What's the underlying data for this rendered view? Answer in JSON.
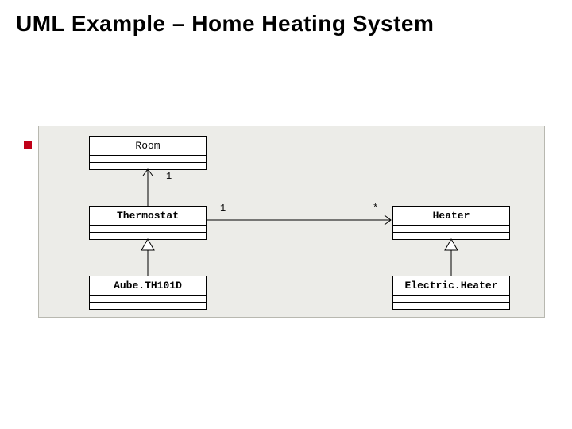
{
  "title": "UML Example – Home Heating System",
  "classes": {
    "room": "Room",
    "thermostat": "Thermostat",
    "heater": "Heater",
    "aube": "Aube.TH101D",
    "electricHeater": "Electric.Heater"
  },
  "multiplicities": {
    "roomSide": "1",
    "thermostatSide": "1",
    "heaterSide": "*"
  },
  "relationships": [
    {
      "from": "Thermostat",
      "to": "Room",
      "type": "association-directed",
      "srcMult": null,
      "dstMult": "1"
    },
    {
      "from": "Thermostat",
      "to": "Heater",
      "type": "association-directed",
      "srcMult": "1",
      "dstMult": "*"
    },
    {
      "from": "Aube.TH101D",
      "to": "Thermostat",
      "type": "generalization"
    },
    {
      "from": "Electric.Heater",
      "to": "Heater",
      "type": "generalization"
    }
  ]
}
